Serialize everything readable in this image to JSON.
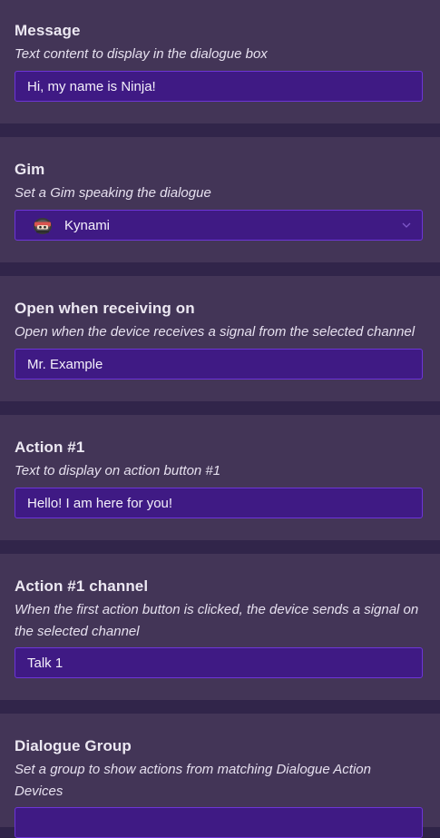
{
  "sections": [
    {
      "title": "Message",
      "description": "Text content to display in the dialogue box",
      "value": "Hi, my name is Ninja!"
    },
    {
      "title": "Gim",
      "description": "Set a Gim speaking the dialogue",
      "value": "Kynami",
      "icon": "ninja-gim-icon"
    },
    {
      "title": "Open when receiving on",
      "description": "Open when the device receives a signal from the selected channel",
      "value": "Mr. Example"
    },
    {
      "title": "Action #1",
      "description": "Text to display on action button #1",
      "value": "Hello! I am here for you!"
    },
    {
      "title": "Action #1 channel",
      "description": "When the first action button is clicked, the device sends a signal on the selected channel",
      "value": "Talk 1"
    },
    {
      "title": "Dialogue Group",
      "description": "Set a group to show actions from matching Dialogue Action Devices",
      "value": ""
    }
  ],
  "colors": {
    "background": "#2f2448",
    "panel": "#433557",
    "field": "#3f1a84",
    "field_border": "#6d35d6"
  }
}
